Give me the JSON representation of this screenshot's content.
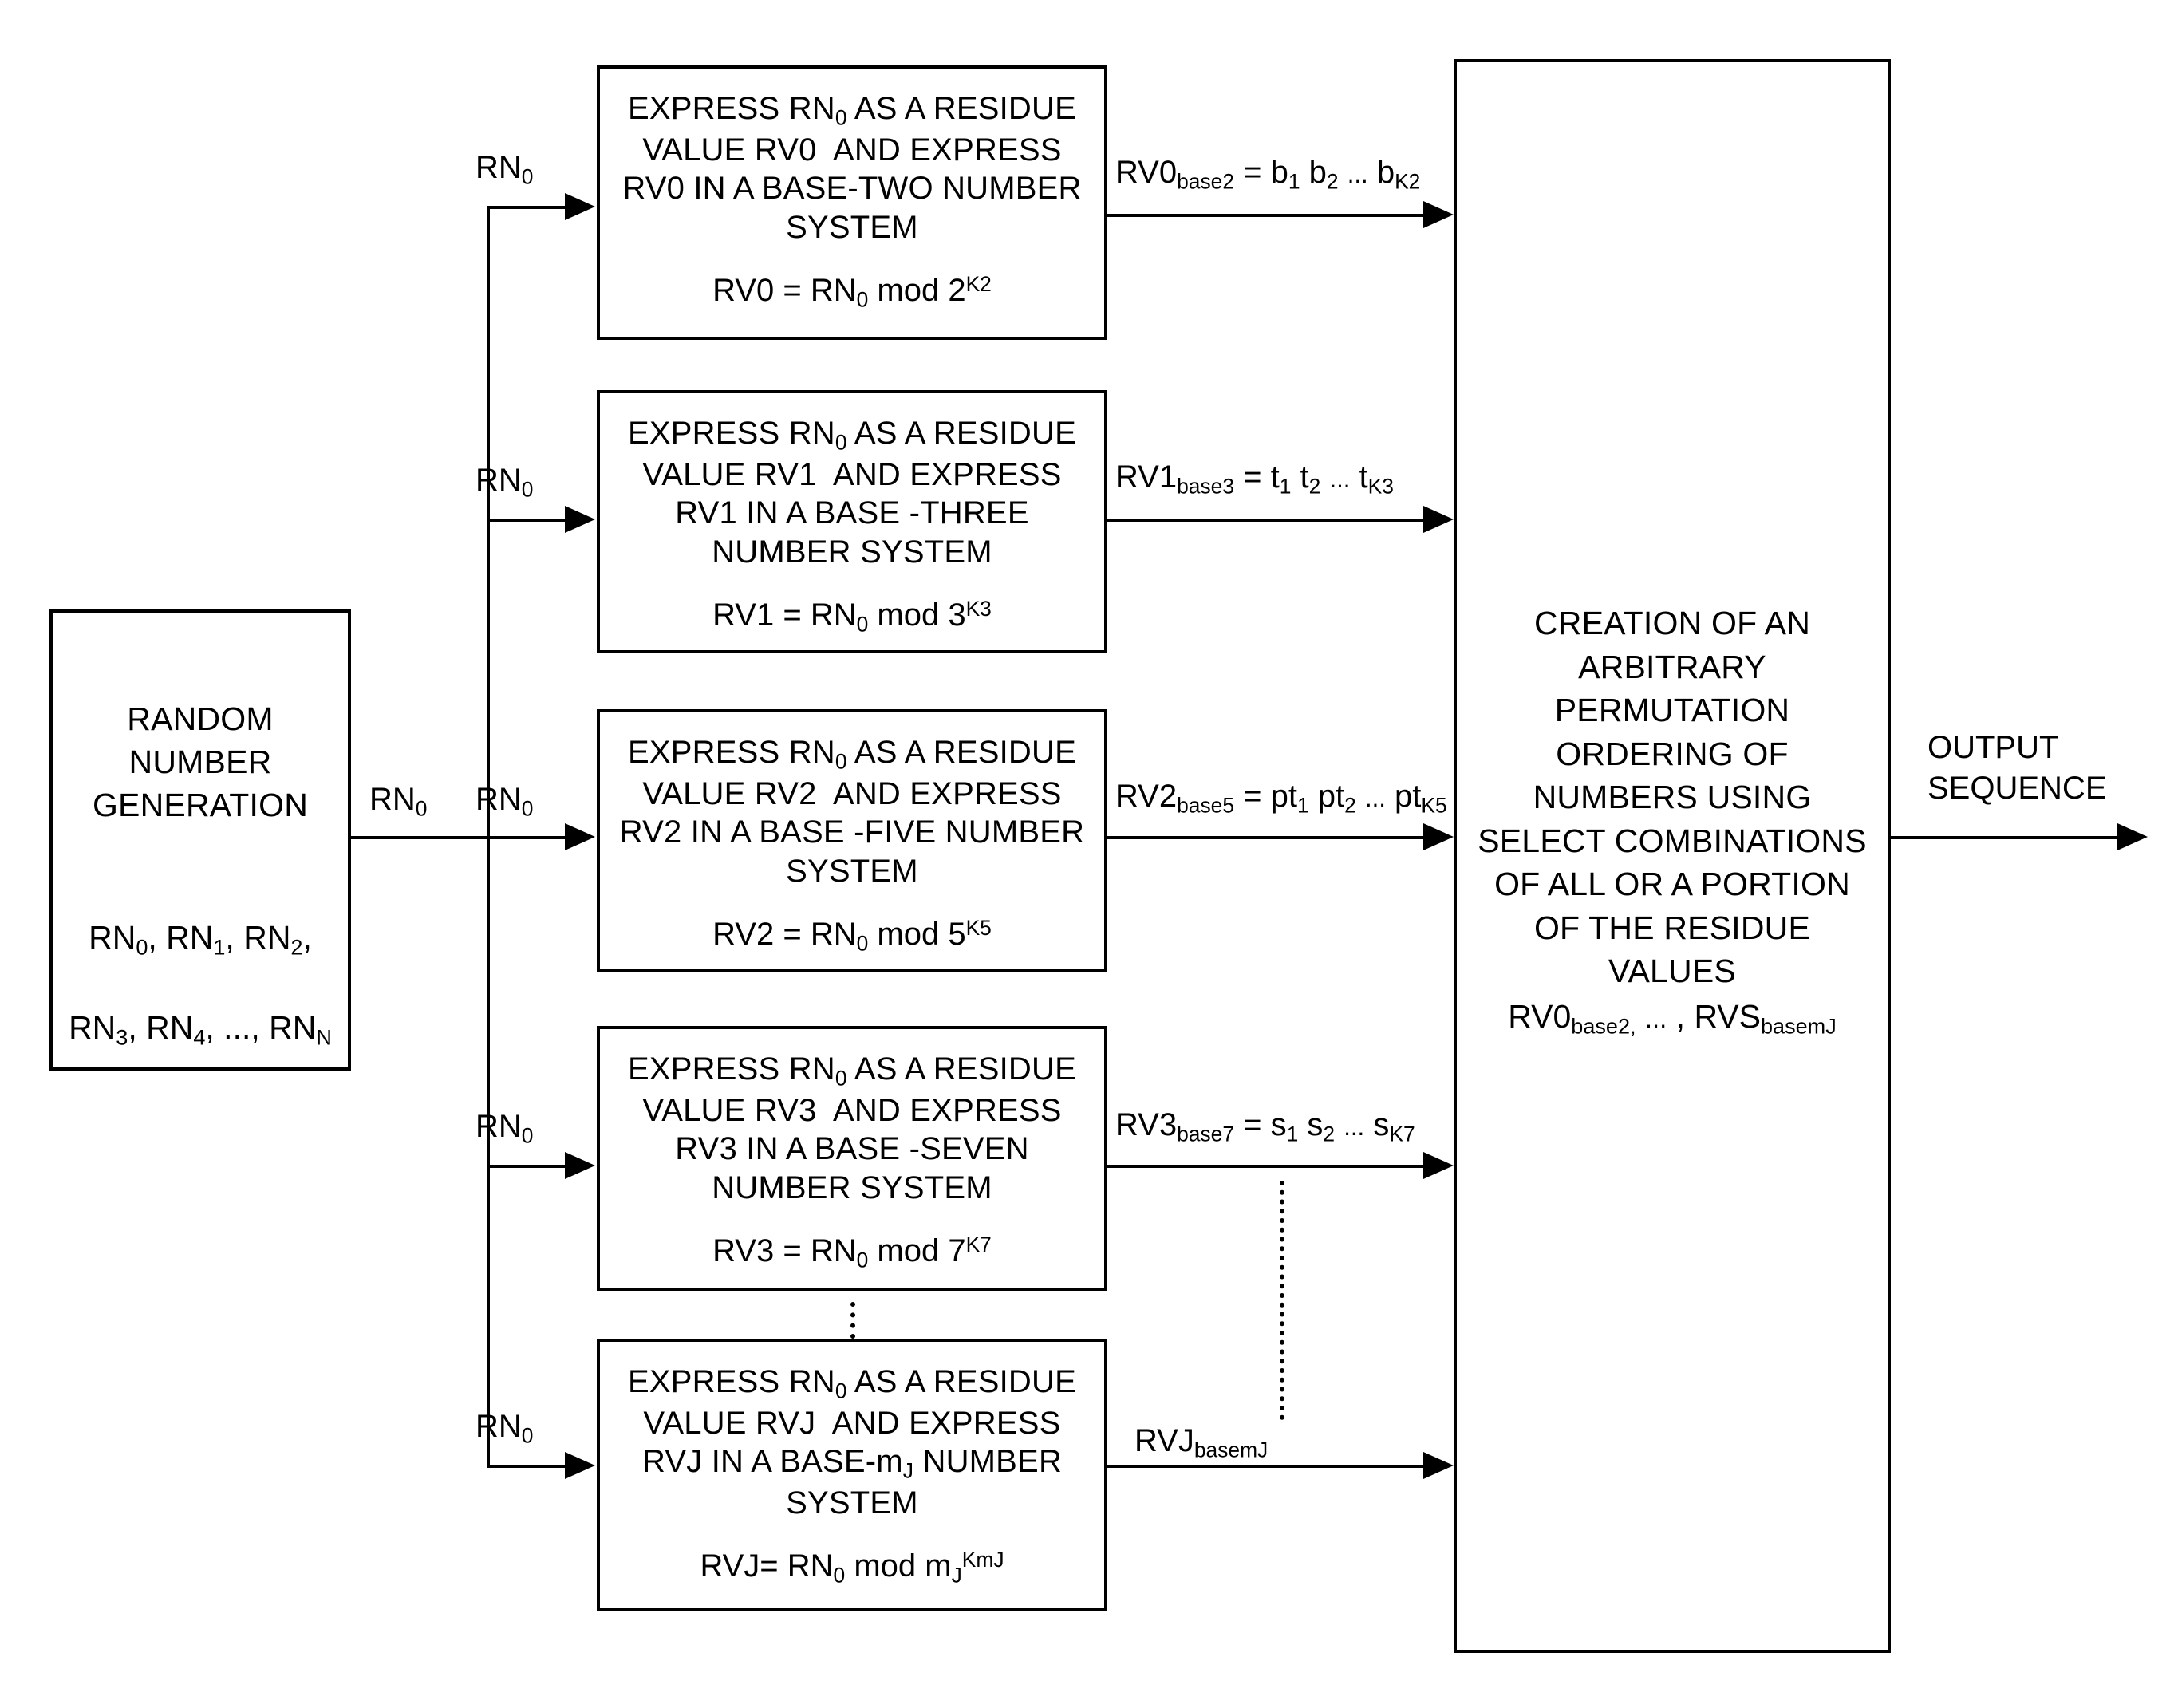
{
  "diagram": {
    "title": "Random number residue-value permutation flow diagram",
    "rng_box": {
      "title": "RANDOM\nNUMBER\nGENERATION",
      "sequence_line1": "RN0, RN1, RN2,",
      "sequence_line2": "RN3, RN4, ..., RNN"
    },
    "process_boxes": [
      {
        "title": "EXPRESS RN0 AS A RESIDUE\nVALUE RV0  AND EXPRESS\nRV0 IN A BASE-TWO NUMBER\nSYSTEM",
        "formula": "RV0 = RN0 mod 2K2",
        "input_label": "RN0",
        "output_label": "RV0base2 = b1 b2 ... bK2"
      },
      {
        "title": "EXPRESS RN0 AS A RESIDUE\nVALUE RV1  AND EXPRESS\nRV1 IN A BASE -THREE\nNUMBER SYSTEM",
        "formula": "RV1 = RN0 mod 3K3",
        "input_label": "RN0",
        "output_label": "RV1base3 = t1 t2 ... tK3"
      },
      {
        "title": "EXPRESS RN0 AS A RESIDUE\nVALUE RV2  AND EXPRESS\nRV2 IN A BASE -FIVE NUMBER\nSYSTEM",
        "formula": "RV2 = RN0 mod 5K5",
        "input_label": "RN0",
        "output_label": "RV2base5 = pt1 pt2 ... ptK5"
      },
      {
        "title": "EXPRESS RN0 AS A RESIDUE\nVALUE RV3  AND EXPRESS\nRV3 IN A BASE -SEVEN\nNUMBER SYSTEM",
        "formula": "RV3 = RN0 mod 7K7",
        "input_label": "RN0",
        "output_label": "RV3base7 = s1 s2 ... sK7"
      },
      {
        "title": "EXPRESS RN0 AS A RESIDUE\nVALUE RVJ  AND EXPRESS\nRVJ IN A BASE-mJ NUMBER\nSYSTEM",
        "formula": "RVJ= RN0 mod mJKmJ",
        "input_label": "RN0",
        "output_label": "RVJbasemJ"
      }
    ],
    "bus_label": "RN0",
    "creation_box": {
      "title": "CREATION OF AN\nARBITRARY\nPERMUTATION\nORDERING OF\nNUMBERS USING\nSELECT COMBINATIONS\nOF ALL OR  A PORTION\nOF THE RESIDUE\nVALUES",
      "formula": "RV0base2, ... , RVSbasemJ"
    },
    "output_label": "OUTPUT\nSEQUENCE",
    "colors": {
      "stroke": "#000000",
      "background": "#ffffff"
    }
  }
}
